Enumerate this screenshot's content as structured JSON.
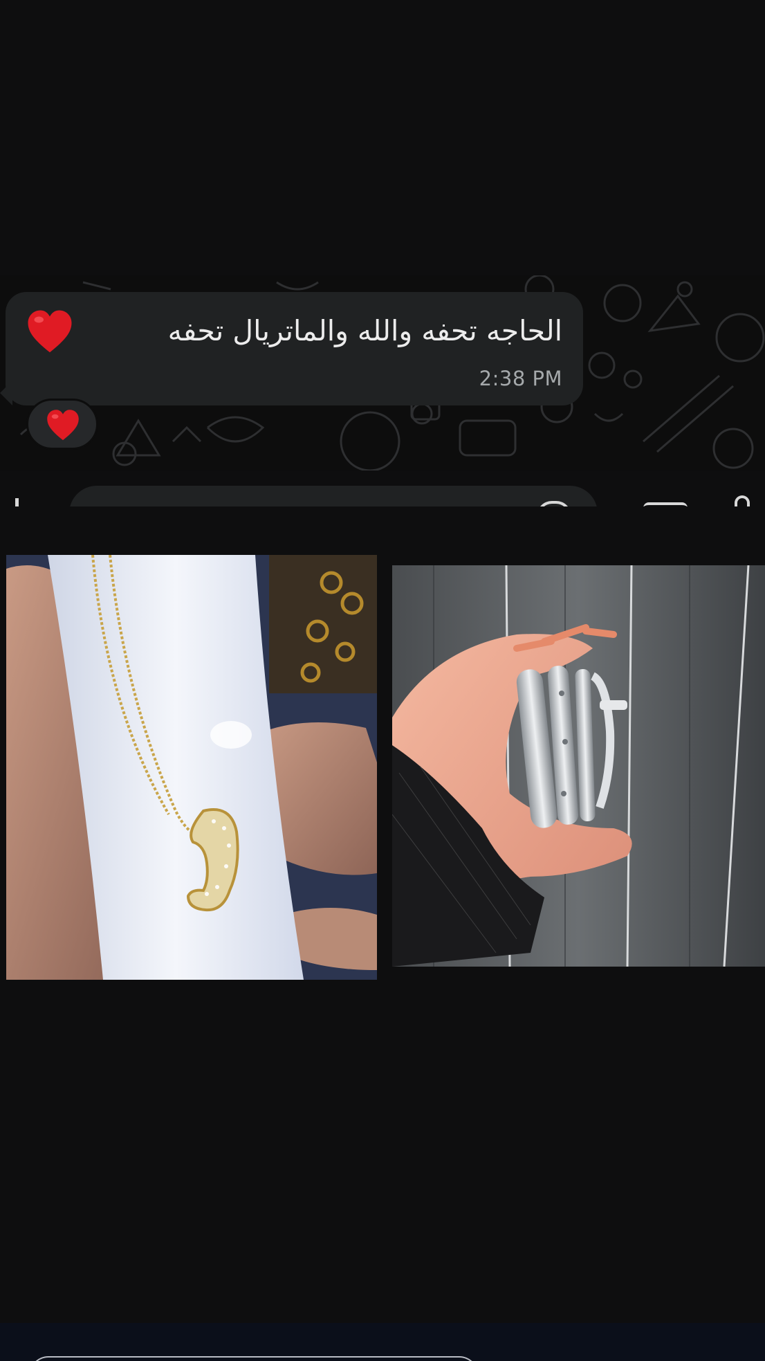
{
  "chat": {
    "message_text": "الحاجه تحفه والله والماتريال تحفه",
    "message_emoji": "red-heart-icon",
    "time": "2:38 PM",
    "reaction_emoji": "red-heart-icon"
  },
  "photos": {
    "left": {
      "subject": "gold-letter-pendant-necklace"
    },
    "right": {
      "subject": "silver-bangles-in-hand"
    }
  },
  "colors": {
    "background": "#0e0e0f",
    "bubble": "#202223",
    "timestamp": "#a5a9ab",
    "heart": "#e01b24"
  }
}
